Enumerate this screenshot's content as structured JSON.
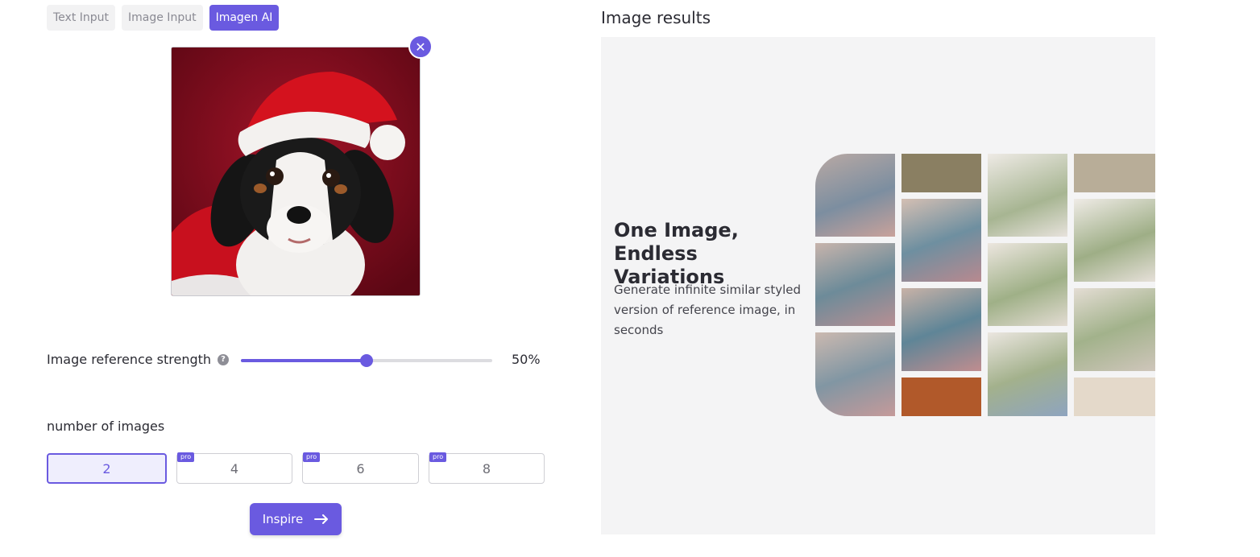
{
  "tabs": [
    {
      "label": "Text Input",
      "active": false
    },
    {
      "label": "Image Input",
      "active": false
    },
    {
      "label": "Imagen AI",
      "active": true
    }
  ],
  "upload": {
    "close_icon": "close-icon",
    "subject": "puppy-in-santa-hat"
  },
  "strength": {
    "label": "Image reference strength",
    "help_icon": "question-icon",
    "value": 50,
    "value_text": "50%"
  },
  "count": {
    "label": "number of images",
    "options": [
      {
        "value": "2",
        "pro": false,
        "selected": true
      },
      {
        "value": "4",
        "pro": true,
        "selected": false
      },
      {
        "value": "6",
        "pro": true,
        "selected": false
      },
      {
        "value": "8",
        "pro": true,
        "selected": false
      }
    ],
    "pro_badge": "pro"
  },
  "inspire": {
    "label": "Inspire",
    "icon": "arrow-right-icon"
  },
  "results": {
    "title": "Image results",
    "heading_line1": "One Image,",
    "heading_line2": "Endless Variations",
    "text": "Generate infinite similar styled version of reference image, in seconds"
  },
  "colors": {
    "accent": "#6a5ae0",
    "panel": "#f4f4f5"
  }
}
